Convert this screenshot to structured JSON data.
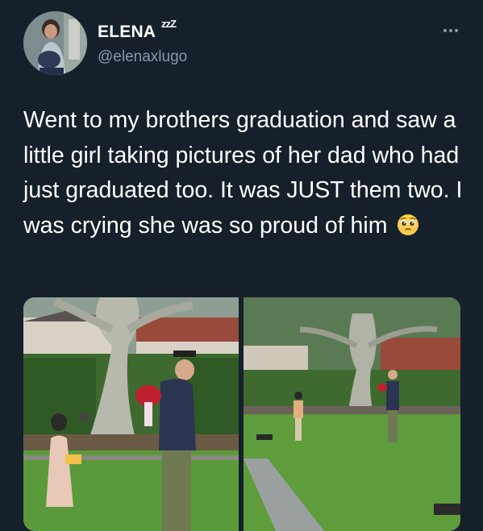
{
  "user": {
    "display_name": "ELENA",
    "name_emoji": "zzZ",
    "handle": "@elenaxlugo"
  },
  "tweet": {
    "text": "Went to my brothers graduation and saw a little girl taking pictures of her dad who had just graduated too. It was JUST them two. I was crying she was so proud of him",
    "emoji": "pleading-face"
  },
  "icons": {
    "more": "more-horizontal-icon"
  },
  "colors": {
    "background": "#15202b",
    "text": "#ffffff",
    "secondary_text": "#8b98a5"
  }
}
